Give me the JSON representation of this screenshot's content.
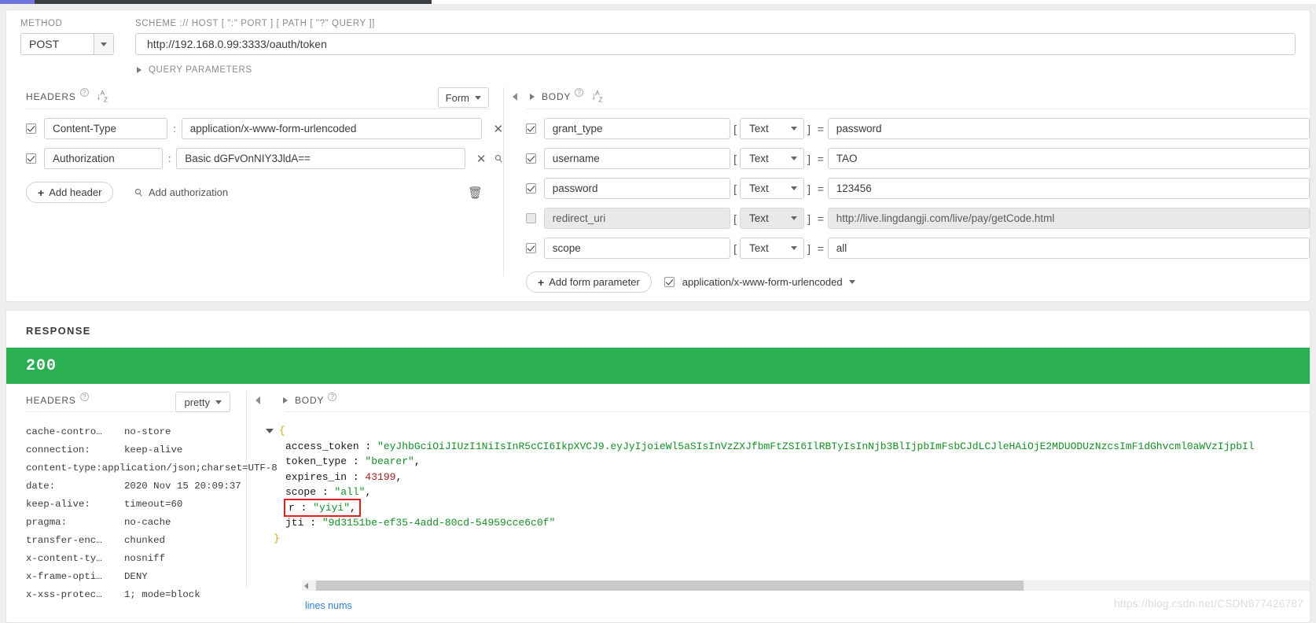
{
  "request": {
    "method_label": "METHOD",
    "method_value": "POST",
    "url_label": "SCHEME :// HOST [ \":\" PORT ] [ PATH [ \"?\" QUERY ]]",
    "url_value": "http://192.168.0.99:3333/oauth/token",
    "query_parameters_label": "QUERY PARAMETERS"
  },
  "headers_panel": {
    "title": "HEADERS",
    "mode_button": "Form",
    "rows": [
      {
        "enabled": true,
        "name": "Content-Type",
        "value": "application/x-www-form-urlencoded",
        "removable": true,
        "has_key_icon": false
      },
      {
        "enabled": true,
        "name": "Authorization",
        "value": "Basic dGFvOnNIY3JldA==",
        "removable": true,
        "has_key_icon": true
      }
    ],
    "add_header_label": "Add header",
    "add_authorization_label": "Add authorization"
  },
  "body_panel": {
    "title": "BODY",
    "rows": [
      {
        "enabled": true,
        "name": "grant_type",
        "type": "Text",
        "value": "password"
      },
      {
        "enabled": true,
        "name": "username",
        "type": "Text",
        "value": "TAO"
      },
      {
        "enabled": true,
        "name": "password",
        "type": "Text",
        "value": "123456"
      },
      {
        "enabled": false,
        "name": "redirect_uri",
        "type": "Text",
        "value": "http://live.lingdangji.com/live/pay/getCode.html"
      },
      {
        "enabled": true,
        "name": "scope",
        "type": "Text",
        "value": "all"
      }
    ],
    "add_param_label": "Add form parameter",
    "content_type_enabled": true,
    "content_type_label": "application/x-www-form-urlencoded"
  },
  "response": {
    "title": "RESPONSE",
    "status_code": "200",
    "status_color": "#2aaf53",
    "headers_title": "HEADERS",
    "pretty_button": "pretty",
    "body_title": "BODY",
    "headers": [
      {
        "key": "cache-contro…",
        "value": "no-store"
      },
      {
        "key": "connection:",
        "value": "keep-alive"
      },
      {
        "key": "content-type:",
        "value": "application/json;charset=UTF-8"
      },
      {
        "key": "date:",
        "value": "2020 Nov 15 20:09:37"
      },
      {
        "key": "keep-alive:",
        "value": "timeout=60"
      },
      {
        "key": "pragma:",
        "value": "no-cache"
      },
      {
        "key": "transfer-enc…",
        "value": "chunked"
      },
      {
        "key": "x-content-ty…",
        "value": "nosniff"
      },
      {
        "key": "x-frame-opti…",
        "value": "DENY"
      },
      {
        "key": "x-xss-protec…",
        "value": "1; mode=block"
      }
    ],
    "json": {
      "open_brace": "{",
      "close_brace": "}",
      "fields": [
        {
          "key": "access_token",
          "sep": " : ",
          "value": "\"eyJhbGciOiJIUzI1NiIsInR5cCI6IkpXVCJ9.eyJyIjoieWl5aSIsInVzZXJfbmFtZSI6IlRBTyIsInNjb3BlIjpbImFsbCJdLCJleHAiOjE2MDUODUzNzcsImF1dGhvcml0aWVzIjpbIl",
          "kind": "string",
          "trailing": "",
          "highlight": false
        },
        {
          "key": "token_type",
          "sep": " : ",
          "value": "\"bearer\"",
          "kind": "string",
          "trailing": ",",
          "highlight": false
        },
        {
          "key": "expires_in",
          "sep": " : ",
          "value": "43199",
          "kind": "number",
          "trailing": ",",
          "highlight": false
        },
        {
          "key": "scope",
          "sep": " : ",
          "value": "\"all\"",
          "kind": "string",
          "trailing": ",",
          "highlight": false
        },
        {
          "key": "r",
          "sep": " : ",
          "value": "\"yiyi\"",
          "kind": "string",
          "trailing": ",",
          "highlight": true
        },
        {
          "key": "jti",
          "sep": " : ",
          "value": "\"9d3151be-ef35-4add-80cd-54959cce6c0f\"",
          "kind": "string",
          "trailing": "",
          "highlight": false
        }
      ]
    },
    "lines_nums_label": "lines nums"
  },
  "watermark": "https://blog.csdn.net/CSDN877426787"
}
